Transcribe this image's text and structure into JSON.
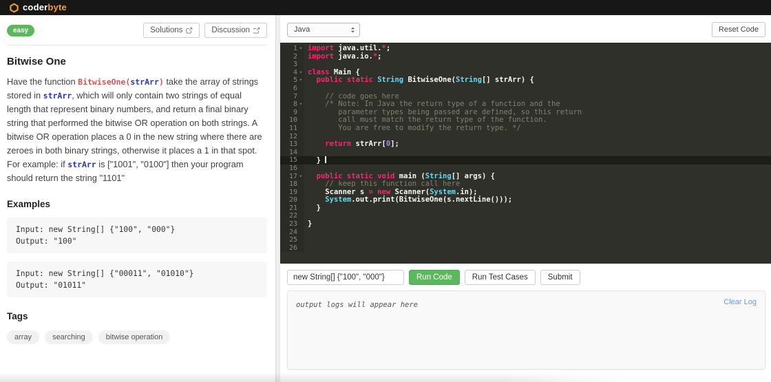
{
  "colors": {
    "brand": "#f0a02a",
    "green": "#5cb85c",
    "ed-bg": "#2f302a",
    "gut-bg": "#2a2b25",
    "syn-kw": "#f92672",
    "syn-ty": "#66d9ef",
    "syn-pl": "#f8f8f2",
    "syn-cm": "#80806f",
    "syn-nm": "#ae81ff"
  },
  "topbar": {
    "logo_coder": "coder",
    "logo_byte": "byte"
  },
  "left": {
    "difficulty": "easy",
    "solutions_label": "Solutions",
    "discussion_label": "Discussion",
    "title": "Bitwise One",
    "description_segments": [
      {
        "s": "text",
        "t": "Have the function "
      },
      {
        "s": "code-red",
        "t": "BitwiseOne("
      },
      {
        "s": "code-blue",
        "t": "strArr"
      },
      {
        "s": "code-red",
        "t": ")"
      },
      {
        "s": "text",
        "t": " take the array of strings stored in "
      },
      {
        "s": "code-blue",
        "t": "strArr"
      },
      {
        "s": "text",
        "t": ", which will only contain two strings of equal length that represent binary numbers, and return a final binary string that performed the bitwise OR operation on both strings. A bitwise OR operation places a 0 in the new string where there are zeroes in both binary strings, otherwise it places a 1 in that spot. For example: if "
      },
      {
        "s": "code-blue",
        "t": "strArr"
      },
      {
        "s": "text",
        "t": " is [\"1001\", \"0100\"] then your program should return the string \"1101\""
      }
    ],
    "examples_heading": "Examples",
    "examples": [
      {
        "input": "Input: new String[] {\"100\", \"000\"}",
        "output": "Output: \"100\""
      },
      {
        "input": "Input: new String[] {\"00011\", \"01010\"}",
        "output": "Output: \"01011\""
      }
    ],
    "tags_heading": "Tags",
    "tags": [
      "array",
      "searching",
      "bitwise operation"
    ]
  },
  "editor": {
    "language": "Java",
    "reset_label": "Reset Code",
    "lines": [
      {
        "n": 1,
        "fold": true,
        "tokens": [
          [
            "kw",
            "import"
          ],
          [
            "pl",
            " java.util."
          ],
          [
            "op",
            "*"
          ],
          [
            "pl",
            ";"
          ]
        ]
      },
      {
        "n": 2,
        "fold": false,
        "tokens": [
          [
            "kw",
            "import"
          ],
          [
            "pl",
            " java.io."
          ],
          [
            "op",
            "*"
          ],
          [
            "pl",
            ";"
          ]
        ]
      },
      {
        "n": 3,
        "fold": false,
        "tokens": []
      },
      {
        "n": 4,
        "fold": true,
        "tokens": [
          [
            "kw",
            "class"
          ],
          [
            "df",
            " Main"
          ],
          [
            "pl",
            " {"
          ]
        ]
      },
      {
        "n": 5,
        "fold": true,
        "tokens": [
          [
            "pl",
            "  "
          ],
          [
            "kw",
            "public"
          ],
          [
            "pl",
            " "
          ],
          [
            "kw",
            "static"
          ],
          [
            "pl",
            " "
          ],
          [
            "ty",
            "String"
          ],
          [
            "df",
            " BitwiseOne"
          ],
          [
            "pl",
            "("
          ],
          [
            "ty",
            "String"
          ],
          [
            "pl",
            "[] "
          ],
          [
            "df",
            "strArr"
          ],
          [
            "pl",
            ") {"
          ]
        ]
      },
      {
        "n": 6,
        "fold": false,
        "tokens": []
      },
      {
        "n": 7,
        "fold": false,
        "tokens": [
          [
            "pl",
            "    "
          ],
          [
            "cm",
            "// code goes here"
          ]
        ]
      },
      {
        "n": 8,
        "fold": true,
        "tokens": [
          [
            "pl",
            "    "
          ],
          [
            "cm",
            "/* Note: In Java the return type of a function and the"
          ]
        ]
      },
      {
        "n": 9,
        "fold": false,
        "tokens": [
          [
            "cm",
            "       parameter types being passed are defined, so this return"
          ]
        ]
      },
      {
        "n": 10,
        "fold": false,
        "tokens": [
          [
            "cm",
            "       call must match the return type of the function."
          ]
        ]
      },
      {
        "n": 11,
        "fold": false,
        "tokens": [
          [
            "cm",
            "       You are free to modify the return type. */"
          ]
        ]
      },
      {
        "n": 12,
        "fold": false,
        "tokens": []
      },
      {
        "n": 13,
        "fold": false,
        "tokens": [
          [
            "pl",
            "    "
          ],
          [
            "kw",
            "return"
          ],
          [
            "df",
            " strArr"
          ],
          [
            "pl",
            "["
          ],
          [
            "nm",
            "0"
          ],
          [
            "pl",
            "];"
          ]
        ]
      },
      {
        "n": 14,
        "fold": false,
        "tokens": []
      },
      {
        "n": 15,
        "fold": false,
        "active": true,
        "cursor": true,
        "tokens": [
          [
            "pl",
            "  } "
          ]
        ]
      },
      {
        "n": 16,
        "fold": false,
        "tokens": []
      },
      {
        "n": 17,
        "fold": true,
        "tokens": [
          [
            "pl",
            "  "
          ],
          [
            "kw",
            "public"
          ],
          [
            "pl",
            " "
          ],
          [
            "kw",
            "static"
          ],
          [
            "pl",
            " "
          ],
          [
            "kw",
            "void"
          ],
          [
            "df",
            " main"
          ],
          [
            "pl",
            " ("
          ],
          [
            "ty",
            "String"
          ],
          [
            "pl",
            "[] args) {"
          ]
        ]
      },
      {
        "n": 18,
        "fold": false,
        "tokens": [
          [
            "pl",
            "    "
          ],
          [
            "cm",
            "// keep this function call here"
          ]
        ]
      },
      {
        "n": 19,
        "fold": false,
        "tokens": [
          [
            "pl",
            "    "
          ],
          [
            "df",
            "Scanner"
          ],
          [
            "pl",
            " s "
          ],
          [
            "op",
            "="
          ],
          [
            "pl",
            " "
          ],
          [
            "kw",
            "new"
          ],
          [
            "df",
            " Scanner"
          ],
          [
            "pl",
            "("
          ],
          [
            "ty",
            "System"
          ],
          [
            "pl",
            ".in);"
          ]
        ]
      },
      {
        "n": 20,
        "fold": false,
        "tokens": [
          [
            "pl",
            "    "
          ],
          [
            "ty",
            "System"
          ],
          [
            "pl",
            ".out.print(BitwiseOne(s.nextLine()));"
          ]
        ]
      },
      {
        "n": 21,
        "fold": false,
        "tokens": [
          [
            "pl",
            "  }"
          ]
        ]
      },
      {
        "n": 22,
        "fold": false,
        "tokens": []
      },
      {
        "n": 23,
        "fold": false,
        "tokens": [
          [
            "pl",
            "}"
          ]
        ]
      },
      {
        "n": 24,
        "fold": false,
        "tokens": []
      },
      {
        "n": 25,
        "fold": false,
        "tokens": []
      },
      {
        "n": 26,
        "fold": false,
        "tokens": []
      }
    ]
  },
  "run": {
    "input_value": "new String[] {\"100\", \"000\"}",
    "run_code": "Run Code",
    "run_tests": "Run Test Cases",
    "submit": "Submit"
  },
  "output": {
    "placeholder": "output logs will appear here",
    "clear": "Clear Log"
  }
}
